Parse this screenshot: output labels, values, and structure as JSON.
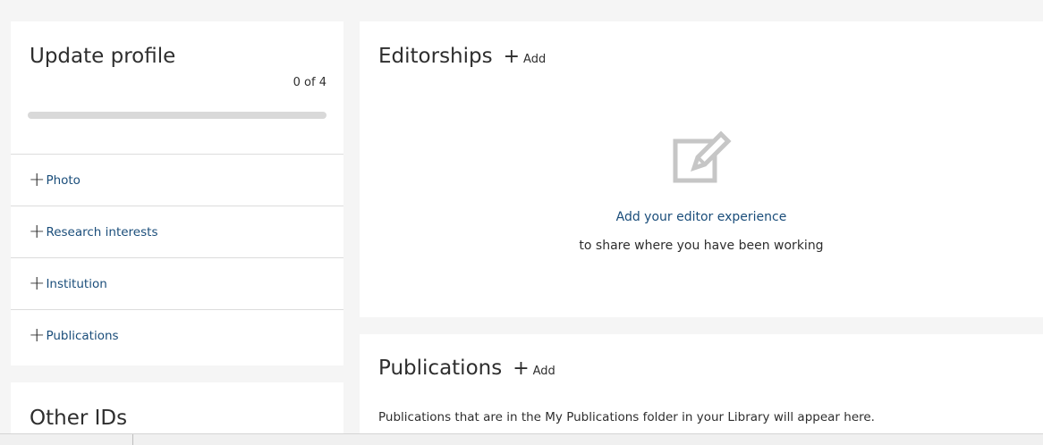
{
  "profile": {
    "title": "Update profile",
    "completion_text": "0 of 4",
    "completion_fraction": 0,
    "accent_color": "#ec6b00",
    "items": [
      {
        "icon": "plus-icon",
        "label": "Photo"
      },
      {
        "icon": "plus-icon",
        "label": "Research interests"
      },
      {
        "icon": "plus-icon",
        "label": "Institution"
      },
      {
        "icon": "plus-icon",
        "label": "Publications"
      }
    ]
  },
  "other_ids": {
    "title": "Other IDs"
  },
  "editorships": {
    "title": "Editorships",
    "add_label": "Add",
    "empty_icon": "edit-note-icon",
    "empty_main": "Add your editor experience",
    "empty_sub": "to share where you have been working"
  },
  "publications": {
    "title": "Publications",
    "add_label": "Add",
    "description": "Publications that are in the My Publications folder in your Library will appear here."
  },
  "colors": {
    "background": "#f5f5f5",
    "card": "#ffffff",
    "link": "#1a4d7a",
    "text": "#2e2e2e"
  }
}
